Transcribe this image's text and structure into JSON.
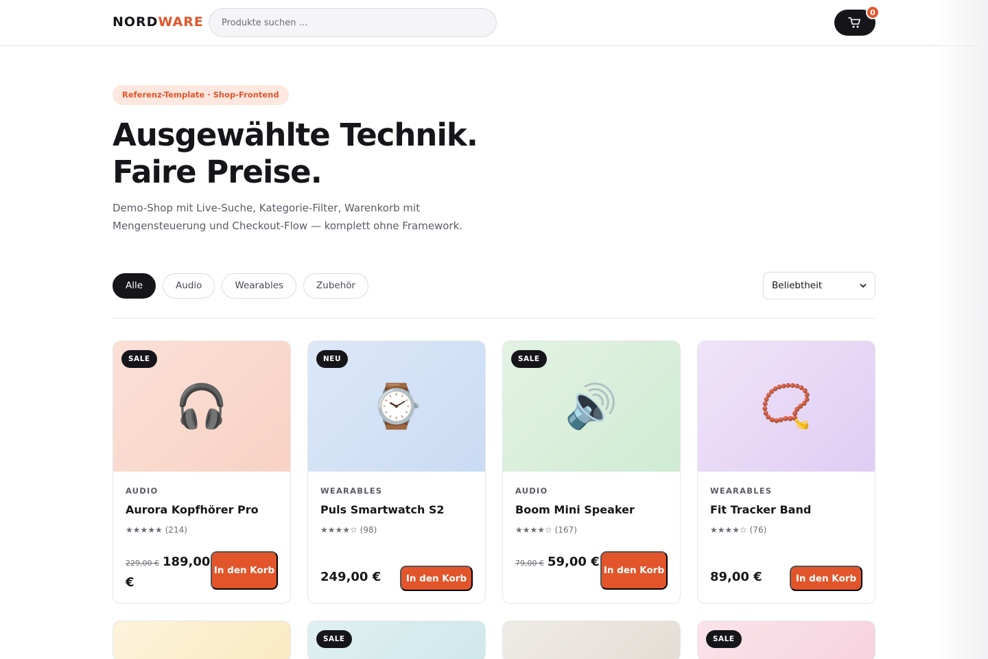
{
  "header": {
    "logo_part1": "NORD",
    "logo_part2": "WARE",
    "search_placeholder": "Produkte suchen …",
    "cart_count": "0",
    "cart_icon": "cart-icon"
  },
  "hero": {
    "pill": "Referenz-Template · Shop-Frontend",
    "title_line1": "Ausgewählte Technik.",
    "title_line2": "Faire Preise.",
    "subtitle": "Demo-Shop mit Live-Suche, Kategorie-Filter, Warenkorb mit Mengensteuerung und Checkout-Flow — komplett ohne Framework."
  },
  "filters": {
    "active": "Alle",
    "chips": [
      "Alle",
      "Audio",
      "Wearables",
      "Zubehör"
    ],
    "sort_selected": "Beliebtheit"
  },
  "colors": {
    "accent": "#e2552b",
    "dark": "#16161a"
  },
  "products": [
    {
      "badge": "SALE",
      "category": "AUDIO",
      "name": "Aurora Kopfhörer Pro",
      "stars": "★★★★★",
      "reviews": "(214)",
      "old_price": "229,00 €",
      "price": "189,00 €",
      "button": "In den Korb",
      "icon": "headphones-icon",
      "emoji": "🎧"
    },
    {
      "badge": "NEU",
      "category": "WEARABLES",
      "name": "Puls Smartwatch S2",
      "stars": "★★★★☆",
      "reviews": "(98)",
      "price": "249,00 €",
      "button": "In den Korb",
      "icon": "watch-icon",
      "emoji": "⌚"
    },
    {
      "badge": "SALE",
      "category": "AUDIO",
      "name": "Boom Mini Speaker",
      "stars": "★★★★☆",
      "reviews": "(167)",
      "old_price": "79,00 €",
      "price": "59,00 €",
      "button": "In den Korb",
      "icon": "speaker-icon",
      "emoji": "🔊"
    },
    {
      "category": "WEARABLES",
      "name": "Fit Tracker Band",
      "stars": "★★★★☆",
      "reviews": "(76)",
      "price": "89,00 €",
      "button": "In den Korb",
      "icon": "bead-bracelet-icon",
      "emoji": "📿"
    }
  ],
  "second_row_badges": [
    "",
    "SALE",
    "",
    "SALE"
  ]
}
